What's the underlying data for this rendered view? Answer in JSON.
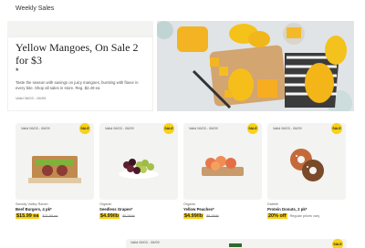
{
  "section": {
    "title": "Weekly Sales"
  },
  "hero": {
    "headline": "Yellow Mangoes, On Sale 2 for $3",
    "asterisk": "*",
    "description": "Taste the season with savings on juicy mangoes, bursting with flavor in every bite. Shop all sales in store. Reg. $2.49 ea",
    "valid": "Valid 06/03 - 06/09"
  },
  "products": [
    {
      "valid": "Valid 06/03 - 06/09",
      "badge": "SALE",
      "brand": "Sancity Valley Ranch",
      "name": "Beef Burgers, 4 pk*",
      "price": "$15.99 ea",
      "was": "$21.99 ea",
      "note": ""
    },
    {
      "valid": "Valid 06/03 - 06/09",
      "badge": "SALE",
      "brand": "Organic",
      "name": "Seedless Grapes*",
      "price": "$4.99/lb",
      "was": "$5.99/lb",
      "note": ""
    },
    {
      "valid": "Valid 06/03 - 06/09",
      "badge": "SALE",
      "brand": "Organic",
      "name": "Yellow Peaches*",
      "price": "$4.99/lb",
      "was": "$5.99/lb",
      "note": ""
    },
    {
      "valid": "Valid 06/03 - 06/09",
      "badge": "SALE",
      "brand": "Dabble",
      "name": "Protein Donuts, 2 pk*",
      "price": "20% off",
      "was": "",
      "note": "Regular prices vary"
    }
  ],
  "bottom": {
    "valid": "Valid 06/03 - 06/09",
    "badge": "SALE"
  },
  "colors": {
    "badge": "#f7d21a",
    "card_bg": "#f3f3f1",
    "accent_green": "#2f6b2f"
  }
}
